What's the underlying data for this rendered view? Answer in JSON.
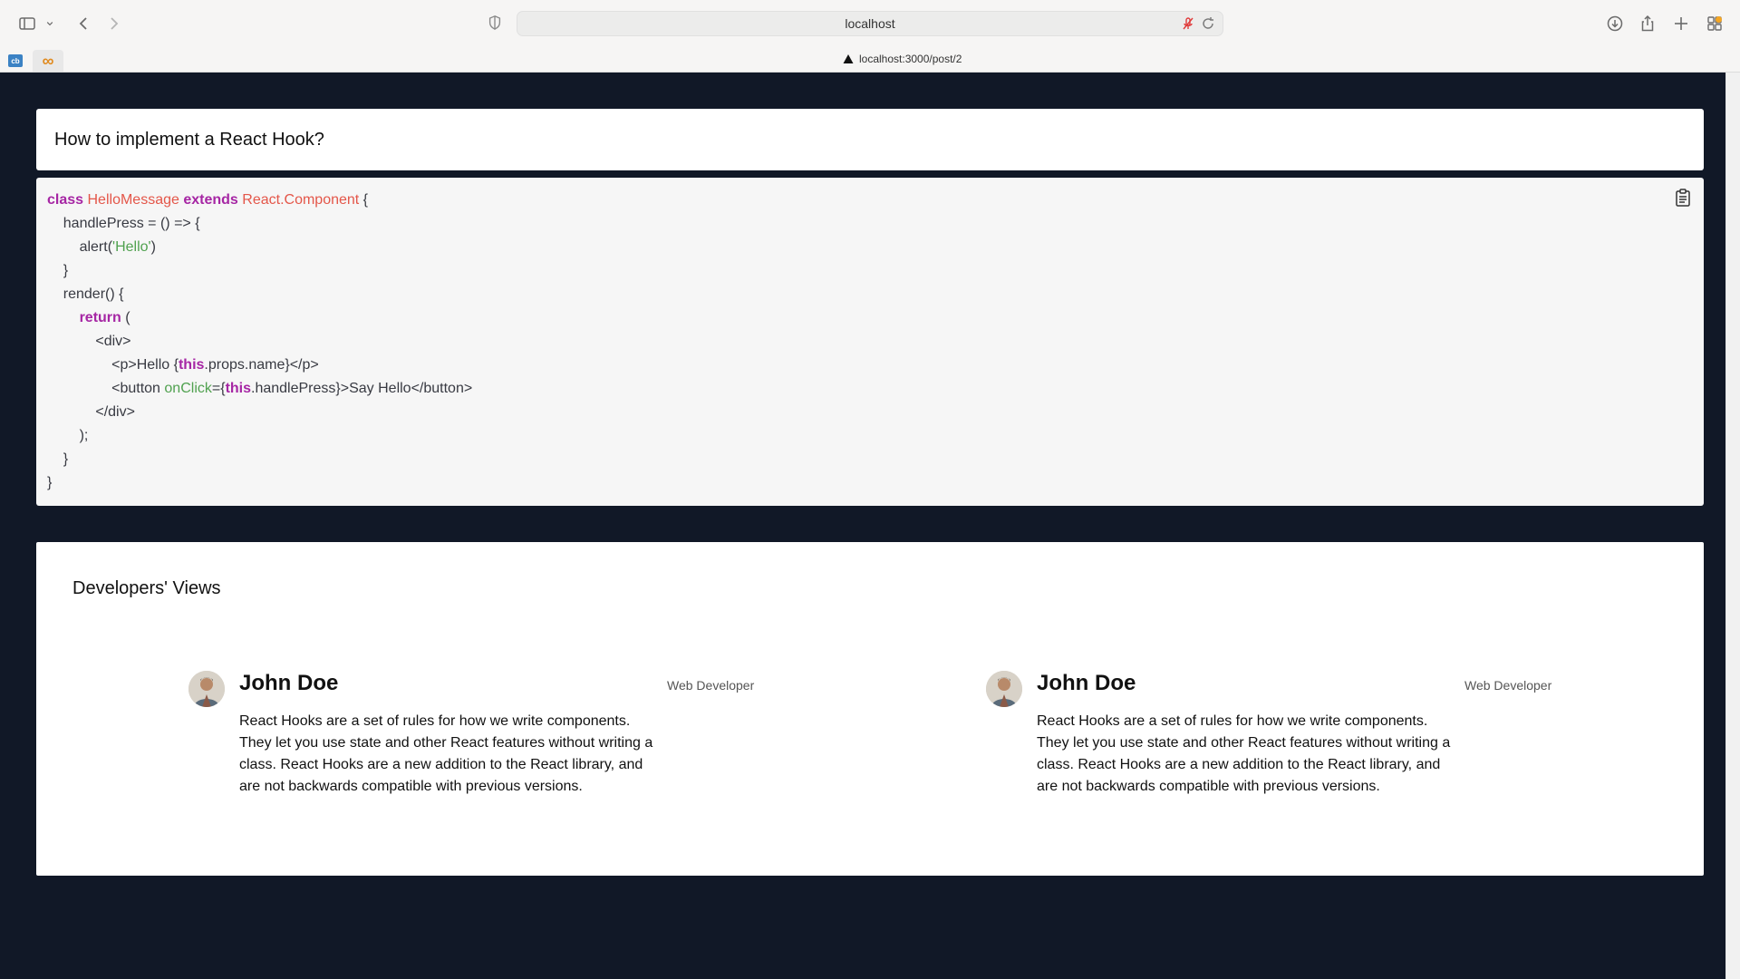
{
  "browser": {
    "url": "localhost",
    "tab_title": "localhost:3000/post/2",
    "favicon_badge": "cb",
    "favicon_symbol": "∞"
  },
  "question": {
    "title": "How to implement a React Hook?"
  },
  "code": {
    "lines": [
      [
        {
          "t": "class",
          "c": "kw"
        },
        {
          "t": " ",
          "c": ""
        },
        {
          "t": "HelloMessage",
          "c": "cls"
        },
        {
          "t": " ",
          "c": ""
        },
        {
          "t": "extends",
          "c": "kw"
        },
        {
          "t": " ",
          "c": ""
        },
        {
          "t": "React.Component",
          "c": "cls"
        },
        {
          "t": " {",
          "c": ""
        }
      ],
      [
        {
          "t": "    handlePress = () => {",
          "c": ""
        }
      ],
      [
        {
          "t": "        alert(",
          "c": ""
        },
        {
          "t": "'Hello'",
          "c": "str"
        },
        {
          "t": ")",
          "c": ""
        }
      ],
      [
        {
          "t": "    }",
          "c": ""
        }
      ],
      [
        {
          "t": "    render() {",
          "c": ""
        }
      ],
      [
        {
          "t": "        ",
          "c": ""
        },
        {
          "t": "return",
          "c": "kw"
        },
        {
          "t": " (",
          "c": ""
        }
      ],
      [
        {
          "t": "            <div>",
          "c": ""
        }
      ],
      [
        {
          "t": "                <p>Hello {",
          "c": ""
        },
        {
          "t": "this",
          "c": "kw"
        },
        {
          "t": ".props.name}</p>",
          "c": ""
        }
      ],
      [
        {
          "t": "                <button ",
          "c": ""
        },
        {
          "t": "onClick",
          "c": "attr"
        },
        {
          "t": "={",
          "c": ""
        },
        {
          "t": "this",
          "c": "kw"
        },
        {
          "t": ".handlePress}>Say Hello</button>",
          "c": ""
        }
      ],
      [
        {
          "t": "            </div>",
          "c": ""
        }
      ],
      [
        {
          "t": "        );",
          "c": ""
        }
      ],
      [
        {
          "t": "    }",
          "c": ""
        }
      ],
      [
        {
          "t": "}",
          "c": ""
        }
      ]
    ]
  },
  "views": {
    "title": "Developers' Views",
    "comments": [
      {
        "author": "John Doe",
        "role": "Web Developer",
        "text": "React Hooks are a set of rules for how we write components. They let you use state and other React features without writing a class. React Hooks are a new addition to the React library, and are not backwards compatible with previous versions."
      },
      {
        "author": "John Doe",
        "role": "Web Developer",
        "text": "React Hooks are a set of rules for how we write components. They let you use state and other React features without writing a class. React Hooks are a new addition to the React library, and are not backwards compatible with previous versions."
      }
    ]
  },
  "colors": {
    "page_bg": "#111827",
    "keyword": "#a626a4",
    "class_name": "#e45649",
    "string": "#50a14f"
  }
}
